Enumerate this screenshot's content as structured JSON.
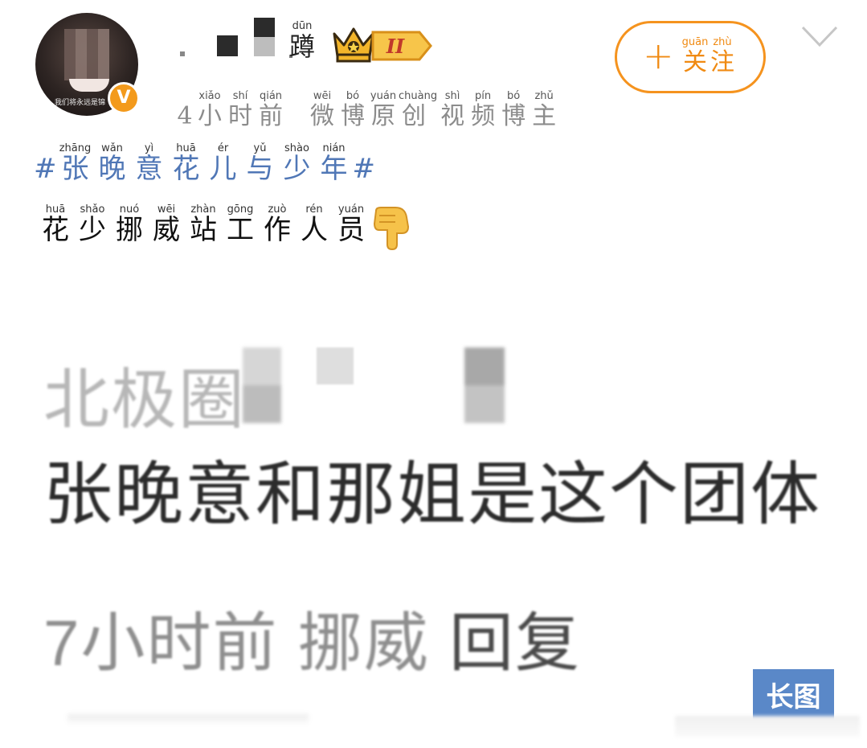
{
  "post": {
    "author": {
      "name_visible_char": {
        "py": "dūn",
        "hz": "蹲"
      },
      "avatar_caption": "我们将永远是锦",
      "verified_badge": "V",
      "level_badge": "II"
    },
    "follow_button": {
      "plus": "+",
      "label": [
        {
          "py": "guān",
          "hz": "关"
        },
        {
          "py": "zhù",
          "hz": "注"
        }
      ]
    },
    "meta": {
      "time": [
        {
          "py": "",
          "hz": "4"
        },
        {
          "py": "xiǎo",
          "hz": "小"
        },
        {
          "py": "shí",
          "hz": "时"
        },
        {
          "py": "qián",
          "hz": "前"
        }
      ],
      "source": [
        {
          "py": "wēi",
          "hz": "微"
        },
        {
          "py": "bó",
          "hz": "博"
        },
        {
          "py": "yuán",
          "hz": "原"
        },
        {
          "py": "chuàng",
          "hz": "创"
        },
        {
          "py": "shì",
          "hz": "视"
        },
        {
          "py": "pín",
          "hz": "频"
        },
        {
          "py": "bó",
          "hz": "博"
        },
        {
          "py": "zhǔ",
          "hz": "主"
        }
      ]
    },
    "topic": {
      "hash": "#",
      "chars": [
        {
          "py": "zhāng",
          "hz": "张"
        },
        {
          "py": "wǎn",
          "hz": "晚"
        },
        {
          "py": "yì",
          "hz": "意"
        },
        {
          "py": "huā",
          "hz": "花"
        },
        {
          "py": "ér",
          "hz": "儿"
        },
        {
          "py": "yǔ",
          "hz": "与"
        },
        {
          "py": "shào",
          "hz": "少"
        },
        {
          "py": "nián",
          "hz": "年"
        }
      ]
    },
    "body": {
      "chars": [
        {
          "py": "huā",
          "hz": "花"
        },
        {
          "py": "shǎo",
          "hz": "少"
        },
        {
          "py": "nuó",
          "hz": "挪"
        },
        {
          "py": "wēi",
          "hz": "威"
        },
        {
          "py": "zhàn",
          "hz": "站"
        },
        {
          "py": "gōng",
          "hz": "工"
        },
        {
          "py": "zuò",
          "hz": "作"
        },
        {
          "py": "rén",
          "hz": "人"
        },
        {
          "py": "yuán",
          "hz": "员"
        }
      ],
      "emoji": "pointing-down-hand-icon"
    },
    "embedded_screenshot": {
      "commenter": "北极圈",
      "comment": "张晚意和那姐是这个团体",
      "time": "7小时前",
      "author": "挪威",
      "reply": "回复"
    },
    "long_image_label": "长图"
  },
  "colors": {
    "accent_orange": "#f5931e",
    "topic_blue": "#5077b6",
    "long_image_blue": "#5a88c8"
  }
}
